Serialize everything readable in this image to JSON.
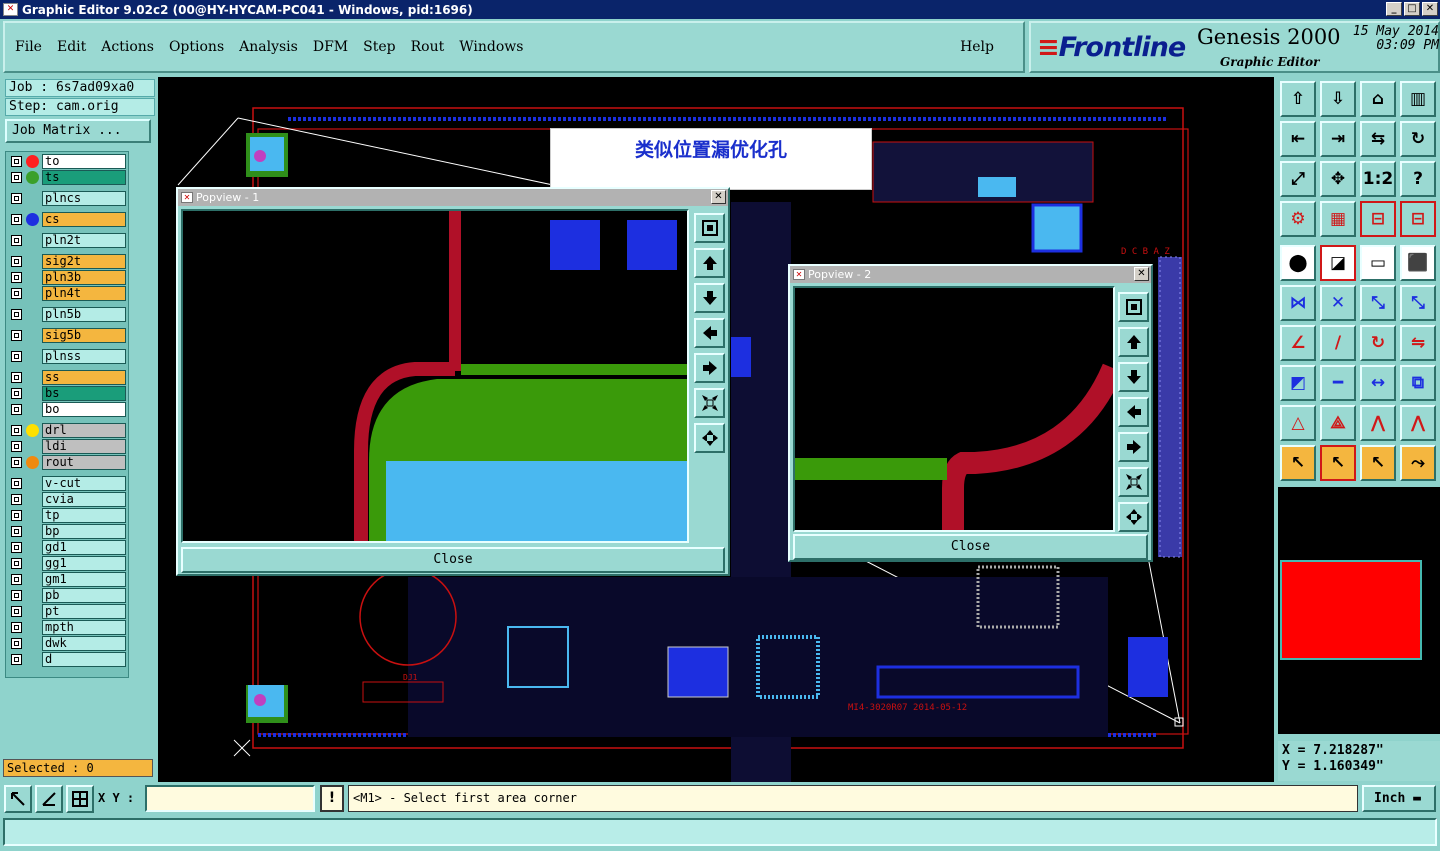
{
  "window": {
    "title": "Graphic Editor 9.02c2 (00@HY-HYCAM-PC041 - Windows, pid:1696)"
  },
  "menu": [
    "File",
    "Edit",
    "Actions",
    "Options",
    "Analysis",
    "DFM",
    "Step",
    "Rout",
    "Windows"
  ],
  "help": "Help",
  "brand": {
    "logo": "Frontline",
    "product": "Genesis 2000",
    "subtitle": "Graphic Editor",
    "date": "15 May 2014",
    "time": "03:09 PM"
  },
  "job": {
    "job_line": "Job : 6s7ad09xa0",
    "step_line": "Step: cam.orig",
    "matrix_button": "Job Matrix ..."
  },
  "layers": [
    {
      "name": "to",
      "color": "#ffffff",
      "dot": "#ff2020"
    },
    {
      "name": "ts",
      "color": "#1a9d7a",
      "dot": "#3aa02a"
    },
    {
      "name": "plncs",
      "color": "#b4ece6",
      "dot": ""
    },
    {
      "name": "cs",
      "color": "#f4b63f",
      "dot": "#1d2fe0"
    },
    {
      "name": "pln2t",
      "color": "#b4ece6",
      "dot": ""
    },
    {
      "name": "sig2t",
      "color": "#f4b63f",
      "dot": ""
    },
    {
      "name": "pln3b",
      "color": "#f4b63f",
      "dot": ""
    },
    {
      "name": "pln4t",
      "color": "#f4b63f",
      "dot": ""
    },
    {
      "name": "pln5b",
      "color": "#b4ece6",
      "dot": ""
    },
    {
      "name": "sig5b",
      "color": "#f4b63f",
      "dot": ""
    },
    {
      "name": "plnss",
      "color": "#b4ece6",
      "dot": ""
    },
    {
      "name": "ss",
      "color": "#f4b63f",
      "dot": ""
    },
    {
      "name": "bs",
      "color": "#1a9d7a",
      "dot": ""
    },
    {
      "name": "bo",
      "color": "#ffffff",
      "dot": ""
    },
    {
      "name": "drl",
      "color": "#bfbfbf",
      "dot": "#ffe000"
    },
    {
      "name": "ldi",
      "color": "#bfbfbf",
      "dot": ""
    },
    {
      "name": "rout",
      "color": "#bfbfbf",
      "dot": "#f08a10"
    },
    {
      "name": "v-cut",
      "color": "#b4ece6",
      "dot": ""
    },
    {
      "name": "cvia",
      "color": "#b4ece6",
      "dot": ""
    },
    {
      "name": "tp",
      "color": "#b4ece6",
      "dot": ""
    },
    {
      "name": "bp",
      "color": "#b4ece6",
      "dot": ""
    },
    {
      "name": "gd1",
      "color": "#b4ece6",
      "dot": ""
    },
    {
      "name": "gg1",
      "color": "#b4ece6",
      "dot": ""
    },
    {
      "name": "gm1",
      "color": "#b4ece6",
      "dot": ""
    },
    {
      "name": "pb",
      "color": "#b4ece6",
      "dot": ""
    },
    {
      "name": "pt",
      "color": "#b4ece6",
      "dot": ""
    },
    {
      "name": "mpth",
      "color": "#b4ece6",
      "dot": ""
    },
    {
      "name": "dwk",
      "color": "#b4ece6",
      "dot": ""
    },
    {
      "name": "d",
      "color": "#b4ece6",
      "dot": ""
    }
  ],
  "selected": "Selected : 0",
  "banner": "类似位置漏优化孔",
  "board_labels": {
    "dcbaz": "D C B A Z",
    "bottom_text": "MI4-3020R07 2014-05-12",
    "dj1": "DJ1"
  },
  "popview1": {
    "title": "Popview - 1",
    "close": "Close"
  },
  "popview2": {
    "title": "Popview - 2",
    "close": "Close"
  },
  "coords": {
    "x": "X = 7.218287\"",
    "y": "Y = 1.160349\""
  },
  "bottom": {
    "xy_label": "X Y :",
    "xy_value": "",
    "message": "<M1> - Select first area corner",
    "unit": "Inch"
  },
  "colors": {
    "red": "#d01818",
    "green": "#3a9a0a",
    "cyan": "#4ab8f0",
    "blue": "#1d2fe0",
    "teal": "#9ad9d2"
  }
}
